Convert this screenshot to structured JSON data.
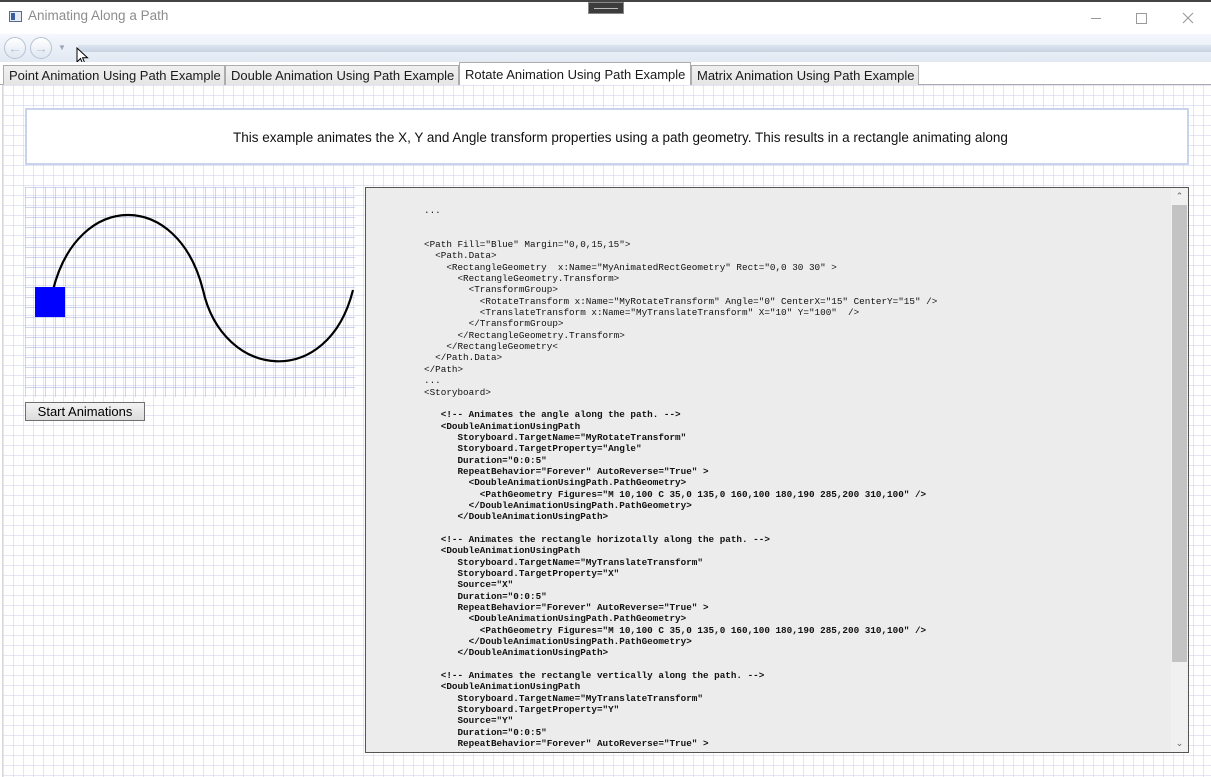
{
  "window": {
    "title": "Animating Along a Path"
  },
  "tabs": [
    {
      "label": "Point Animation Using Path Example",
      "selected": false
    },
    {
      "label": "Double Animation Using Path Example",
      "selected": false
    },
    {
      "label": "Rotate Animation Using Path Example",
      "selected": true
    },
    {
      "label": "Matrix Animation Using Path Example",
      "selected": false
    }
  ],
  "description": "This example animates the X, Y and Angle transform properties using a path geometry. This results in a rectangle animating along ",
  "start_button": "Start Animations",
  "colors": {
    "animated_rect": "#0000ff",
    "path_stroke": "#000000"
  },
  "code_lines": [
    "...",
    "",
    "",
    "<Path Fill=\"Blue\" Margin=\"0,0,15,15\">",
    "  <Path.Data>",
    "    <RectangleGeometry  x:Name=\"MyAnimatedRectGeometry\" Rect=\"0,0 30 30\" >",
    "      <RectangleGeometry.Transform>",
    "        <TransformGroup>",
    "          <RotateTransform x:Name=\"MyRotateTransform\" Angle=\"0\" CenterX=\"15\" CenterY=\"15\" />",
    "          <TranslateTransform x:Name=\"MyTranslateTransform\" X=\"10\" Y=\"100\"  />",
    "        </TransformGroup>",
    "      </RectangleGeometry.Transform>",
    "    </RectangleGeometry<",
    "  </Path.Data>",
    "</Path>",
    "...",
    "<Storyboard>",
    "",
    "   <!-- Animates the angle along the path. -->",
    "   <DoubleAnimationUsingPath",
    "      Storyboard.TargetName=\"MyRotateTransform\"",
    "      Storyboard.TargetProperty=\"Angle\"",
    "      Duration=\"0:0:5\"",
    "      RepeatBehavior=\"Forever\" AutoReverse=\"True\" >",
    "        <DoubleAnimationUsingPath.PathGeometry>",
    "          <PathGeometry Figures=\"M 10,100 C 35,0 135,0 160,100 180,190 285,200 310,100\" />",
    "        </DoubleAnimationUsingPath.PathGeometry>",
    "      </DoubleAnimationUsingPath>",
    "",
    "   <!-- Animates the rectangle horizotally along the path. -->",
    "   <DoubleAnimationUsingPath",
    "      Storyboard.TargetName=\"MyTranslateTransform\"",
    "      Storyboard.TargetProperty=\"X\"",
    "      Source=\"X\"",
    "      Duration=\"0:0:5\"",
    "      RepeatBehavior=\"Forever\" AutoReverse=\"True\" >",
    "        <DoubleAnimationUsingPath.PathGeometry>",
    "          <PathGeometry Figures=\"M 10,100 C 35,0 135,0 160,100 180,190 285,200 310,100\" />",
    "        </DoubleAnimationUsingPath.PathGeometry>",
    "      </DoubleAnimationUsingPath>",
    "",
    "   <!-- Animates the rectangle vertically along the path. -->",
    "   <DoubleAnimationUsingPath",
    "      Storyboard.TargetName=\"MyTranslateTransform\"",
    "      Storyboard.TargetProperty=\"Y\"",
    "      Source=\"Y\"",
    "      Duration=\"0:0:5\"",
    "      RepeatBehavior=\"Forever\" AutoReverse=\"True\" >"
  ]
}
